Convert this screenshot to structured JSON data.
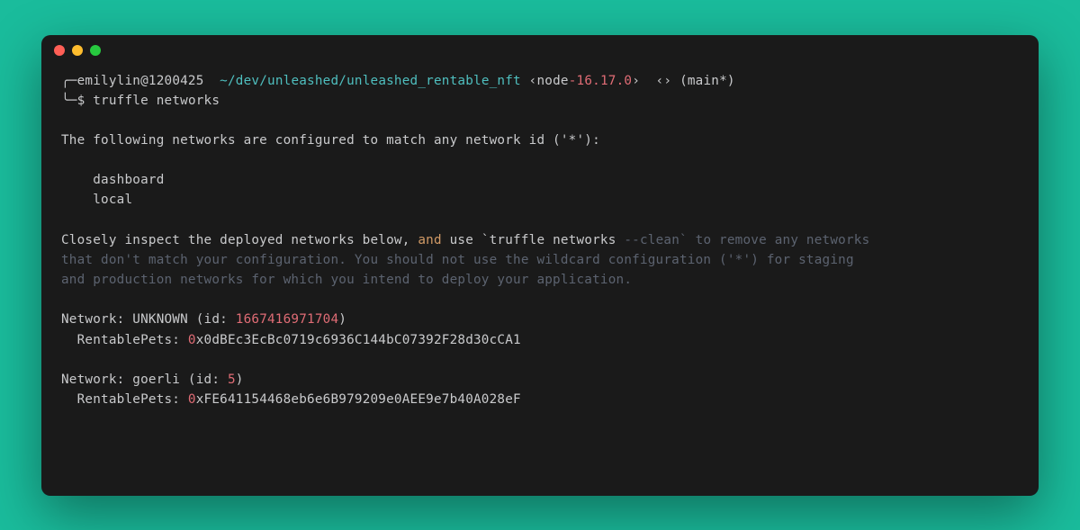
{
  "prompt": {
    "corner_top": "╭─",
    "corner_bottom": "╰─",
    "user": "emilylin@1200425",
    "path": "~/dev/unleashed/unleashed_rentable_nft",
    "node_label": "‹node",
    "node_dash": "-",
    "node_version": "16.17.0",
    "node_close": "›",
    "diamond": "‹›",
    "branch": "(main*)",
    "symbol": "$",
    "command": "truffle networks"
  },
  "out": {
    "configured_line": "The following networks are configured to match any network id ('*'):",
    "net1": "    dashboard",
    "net2": "    local",
    "inspect_pre": "Closely inspect the deployed networks below, ",
    "inspect_and": "and",
    "inspect_mid": " use `truffle networks ",
    "inspect_flag": "--clean",
    "inspect_tail1": "` to remove any networks",
    "inspect_tail2": "that don't match your configuration. You should not use the wildcard configuration ('*') for staging",
    "inspect_tail3": "and production networks for which you intend to deploy your application.",
    "n1_label": "Network: UNKNOWN (id: ",
    "n1_id": "1667416971704",
    "n1_close": ")",
    "n1_contract": "  RentablePets: ",
    "n1_zero": "0",
    "n1_addr": "x0dBEc3EcBc0719c6936C144bC07392F28d30cCA1",
    "n2_label": "Network: goerli (id: ",
    "n2_id": "5",
    "n2_close": ")",
    "n2_contract": "  RentablePets: ",
    "n2_zero": "0",
    "n2_addr": "xFE641154468eb6e6B979209e0AEE9e7b40A028eF"
  }
}
